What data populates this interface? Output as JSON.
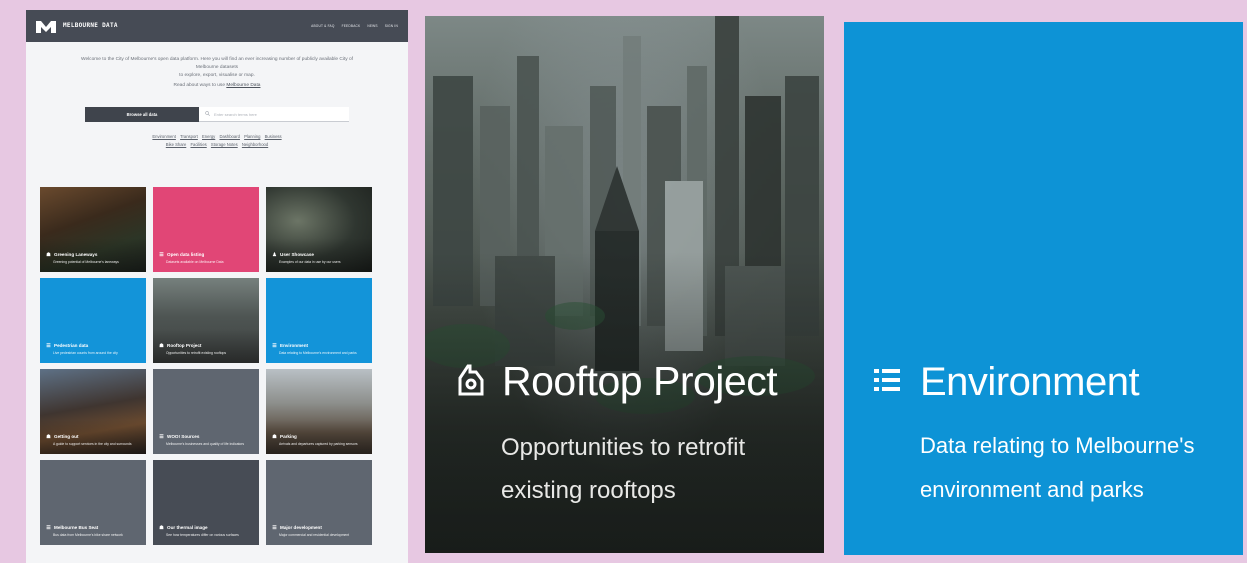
{
  "site": {
    "logo_text": "MELBOURNE DATA",
    "nav": [
      "ABOUT & FAQ",
      "FEEDBACK",
      "NEWS",
      "SIGN IN"
    ]
  },
  "intro": {
    "line1": "Welcome to the City of Melbourne's open data platform. Here you will find an ever increasing number of publicly available City of Melbourne datasets",
    "line2": "to explore, export, visualise or map.",
    "line3_prefix": "Read about ways to use",
    "line3_link": "Melbourne Data"
  },
  "browse_button": "Browse all data",
  "search_placeholder": "Enter search terms here",
  "tags": [
    "Environment",
    "Transport",
    "Energy",
    "Dashboard",
    "Planning",
    "Business",
    "Bike Share",
    "Facilities",
    "Storage Notes",
    "Neighborhood"
  ],
  "tiles": [
    {
      "title": "Greening Laneways",
      "desc": "Greening potential of Melbourne's laneways",
      "icon": "building-icon"
    },
    {
      "title": "Open data listing",
      "desc": "Datasets available on Melbourne Data",
      "icon": "list-icon"
    },
    {
      "title": "User Showcase",
      "desc": "Examples of our data in use by our users",
      "icon": "person-icon"
    },
    {
      "title": "Pedestrian data",
      "desc": "Live pedestrian counts from around the city",
      "icon": "list-icon"
    },
    {
      "title": "Rooftop Project",
      "desc": "Opportunities to retrofit existing rooftops",
      "icon": "building-icon"
    },
    {
      "title": "Environment",
      "desc": "Data relating to Melbourne's environment and parks",
      "icon": "list-icon"
    },
    {
      "title": "Getting out",
      "desc": "A guide to support services in the city and surrounds",
      "icon": "building-icon"
    },
    {
      "title": "WOO! Sources",
      "desc": "Melbourne's businesses and quality of life indicators",
      "icon": "list-icon"
    },
    {
      "title": "Parking",
      "desc": "Arrivals and departures captured by parking sensors",
      "icon": "building-icon"
    },
    {
      "title": "Melbourne Bus Seat",
      "desc": "Bus data from Melbourne's bike share network",
      "icon": "list-icon"
    },
    {
      "title": "Our thermal image",
      "desc": "See how temperatures differ on various surfaces",
      "icon": "building-icon"
    },
    {
      "title": "Major development",
      "desc": "Major commercial and residential development",
      "icon": "list-icon"
    }
  ],
  "rooftop": {
    "title": "Rooftop Project",
    "desc": "Opportunities to retrofit existing rooftops",
    "icon": "building-icon"
  },
  "environment": {
    "title": "Environment",
    "desc": "Data relating to Melbourne's environment and parks",
    "icon": "list-icon"
  },
  "colors": {
    "background": "#e7c8e2",
    "header": "#464b55",
    "accent_blue": "#0d93d6",
    "accent_pink": "#e14676",
    "slate": "#5f6670"
  }
}
